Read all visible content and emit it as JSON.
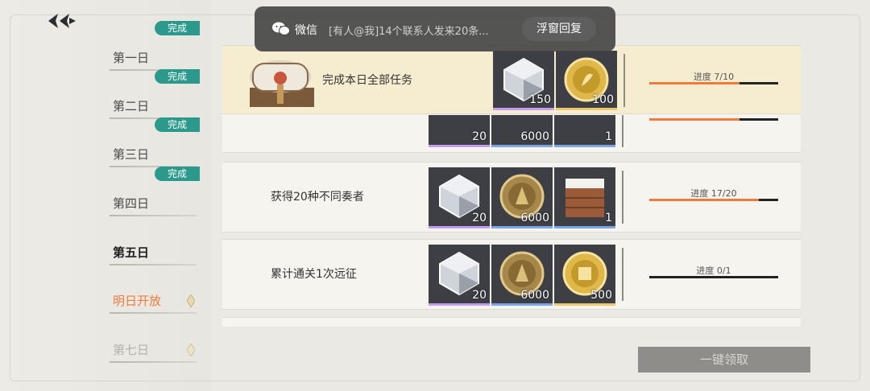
{
  "notification": {
    "app_name": "微信",
    "message": "[有人@我]14个联系人发来20条...",
    "reply_label": "浮窗回复"
  },
  "days": [
    {
      "label": "第一日",
      "badge": "完成",
      "state": "done"
    },
    {
      "label": "第二日",
      "badge": "完成",
      "state": "done"
    },
    {
      "label": "第三日",
      "badge": "完成",
      "state": "done"
    },
    {
      "label": "第四日",
      "badge": "完成",
      "state": "done"
    },
    {
      "label": "第五日",
      "badge": "",
      "state": "active"
    },
    {
      "label": "明日开放",
      "badge": "",
      "state": "open"
    },
    {
      "label": "第七日",
      "badge": "",
      "state": "locked"
    }
  ],
  "tasks": [
    {
      "title": "完成本日全部任务",
      "progress_text": "进度 7/10",
      "progress_value": 0.7,
      "rewards": [
        {
          "icon": "crystal-icon",
          "count": "150"
        },
        {
          "icon": "gold-token-icon",
          "count": "100"
        }
      ]
    },
    {
      "title": "",
      "progress_text": "",
      "progress_value": 0.7,
      "rewards": [
        {
          "icon": "crystal-icon",
          "count": "20"
        },
        {
          "icon": "coin-icon",
          "count": "6000"
        },
        {
          "icon": "wooden-crate-icon",
          "count": "1"
        }
      ]
    },
    {
      "title": "获得20种不同奏者",
      "progress_text": "进度 17/20",
      "progress_value": 0.85,
      "rewards": [
        {
          "icon": "crystal-icon",
          "count": "20"
        },
        {
          "icon": "coin-icon",
          "count": "6000"
        },
        {
          "icon": "wooden-crate-icon",
          "count": "1"
        }
      ]
    },
    {
      "title": "累计通关1次远征",
      "progress_text": "进度 0/1",
      "progress_value": 0,
      "rewards": [
        {
          "icon": "crystal-icon",
          "count": "20"
        },
        {
          "icon": "coin-icon",
          "count": "6000"
        },
        {
          "icon": "gold-token-icon",
          "count": "500"
        }
      ]
    }
  ],
  "claim_all_label": "一键领取",
  "colors": {
    "badge_teal": "#2b9a8c",
    "progress_orange": "#f07a3a",
    "open_day_orange": "#f07a3a"
  }
}
